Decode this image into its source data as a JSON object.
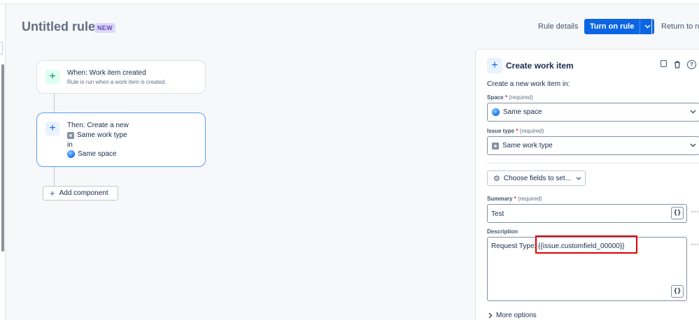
{
  "header": {
    "title": "Untitled rule",
    "badge": "NEW",
    "rule_details": "Rule details",
    "turn_on": "Turn on rule",
    "return_link": "Return to ru"
  },
  "canvas": {
    "trigger": {
      "title": "When: Work item created",
      "subtitle": "Rule is run when a work item is created."
    },
    "action": {
      "line1": "Then: Create a new",
      "work_type": "Same work type",
      "in_word": "in",
      "space": "Same space"
    },
    "add_component": "Add component"
  },
  "panel": {
    "title": "Create work item",
    "subtitle": "Create a new work item in:",
    "space": {
      "label": "Space",
      "star": "*",
      "required": "(required)",
      "value": "Same space"
    },
    "issue_type": {
      "label": "Issue type",
      "star": "*",
      "required": "(required)",
      "value": "Same work type"
    },
    "choose_fields": "Choose fields to set...",
    "summary": {
      "label": "Summary",
      "star": "*",
      "required": "(required)",
      "value": "Test",
      "brace": "{}"
    },
    "description": {
      "label": "Description",
      "value": "Request Type: {{issue.customfield_00000}}",
      "brace": "{}"
    },
    "more_options": "More options",
    "dots": "···"
  },
  "colors": {
    "primary": "#0c66e4",
    "highlight": "#e00000",
    "badge_bg": "#dfd8fd"
  }
}
